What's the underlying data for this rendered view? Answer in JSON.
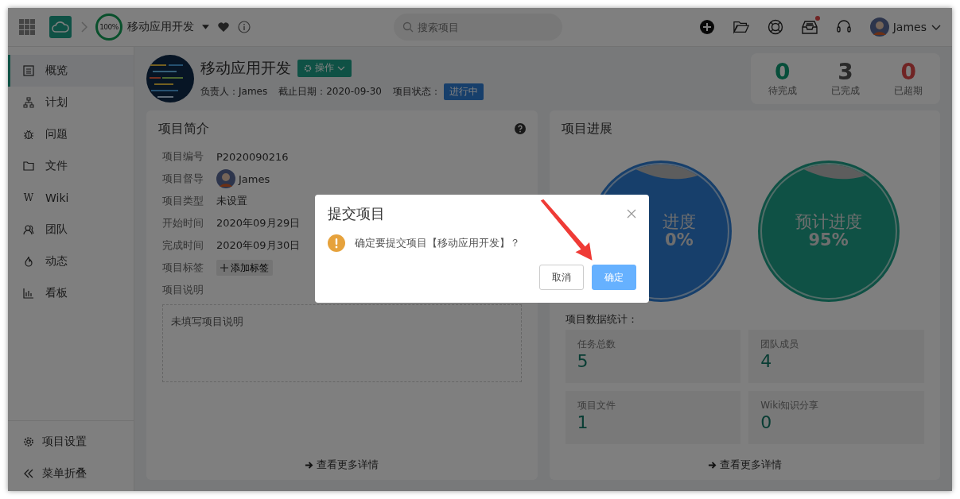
{
  "topbar": {
    "progress": "100%",
    "project": "移动应用开发",
    "search": {
      "placeholder": "搜索项目"
    },
    "user": "James",
    "notification": true
  },
  "sidebar": {
    "items": [
      {
        "label": "概览",
        "selected": true
      },
      {
        "label": "计划",
        "selected": false
      },
      {
        "label": "问题",
        "selected": false
      },
      {
        "label": "文件",
        "selected": false
      },
      {
        "label": "Wiki",
        "glyph": "W",
        "selected": false
      },
      {
        "label": "团队",
        "selected": false
      },
      {
        "label": "动态",
        "selected": false
      },
      {
        "label": "看板",
        "selected": false
      }
    ],
    "bottom": [
      {
        "label": "项目设置"
      },
      {
        "label": "菜单折叠"
      }
    ]
  },
  "header": {
    "title": "移动应用开发",
    "action": "操作",
    "meta": [
      {
        "kind": "text",
        "text": "负责人：James"
      },
      {
        "kind": "text",
        "text": "截止日期：2020-09-30"
      },
      {
        "kind": "status",
        "text": "项目状态：",
        "badge": "进行中"
      }
    ]
  },
  "counters": [
    {
      "value": "0",
      "label": "待完成"
    },
    {
      "value": "3",
      "label": "已完成"
    },
    {
      "value": "0",
      "label": "已超期"
    }
  ],
  "intro": {
    "title": "项目简介",
    "fields": [
      {
        "kind": "text",
        "label": "项目编号",
        "value": "P2020090216"
      },
      {
        "kind": "person",
        "label": "项目督导",
        "value": "James"
      },
      {
        "kind": "text",
        "label": "项目类型",
        "value": "未设置"
      },
      {
        "kind": "text",
        "label": "开始时间",
        "value": "2020年09月29日"
      },
      {
        "kind": "text",
        "label": "完成时间",
        "value": "2020年09月30日"
      },
      {
        "kind": "tag",
        "label": "项目标签",
        "value": "添加标签"
      }
    ],
    "description_label": "项目说明",
    "description_placeholder": "未填写项目说明",
    "more": "查看更多详情"
  },
  "progress": {
    "title": "项目进展",
    "gauges": [
      {
        "label": "进度",
        "value": "0%"
      },
      {
        "label": "预计进度",
        "value": "95%"
      }
    ],
    "stats_title": "项目数据统计：",
    "stats": [
      {
        "label": "任务总数",
        "value": "5"
      },
      {
        "label": "团队成员",
        "value": "4"
      },
      {
        "label": "项目文件",
        "value": "1"
      },
      {
        "label": "Wiki知识分享",
        "value": "0"
      }
    ],
    "more": "查看更多详情"
  },
  "modal": {
    "title": "提交项目",
    "message": "确定要提交项目【移动应用开发】？",
    "buttons": [
      {
        "kind": "default",
        "label": "取消"
      },
      {
        "kind": "primary",
        "label": "确定"
      }
    ]
  }
}
